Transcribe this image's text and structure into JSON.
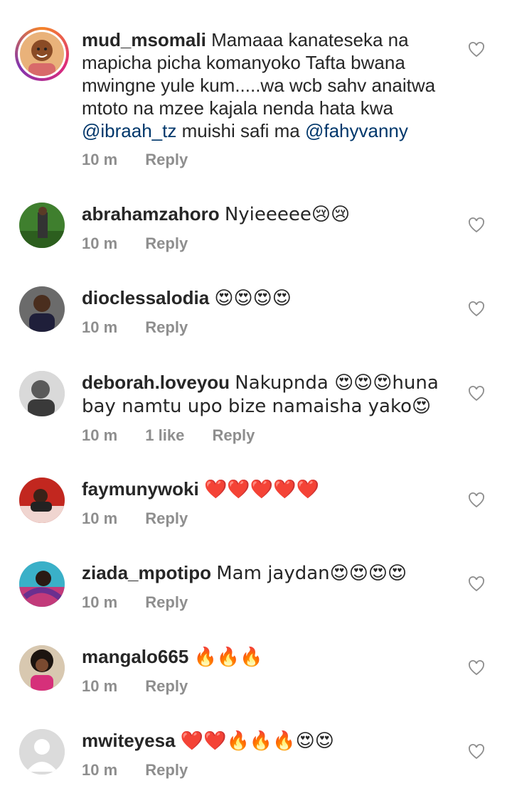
{
  "comments": [
    {
      "username": "mud_msomali",
      "text_parts": [
        "Mamaaa kanateseka na mapicha picha komanyoko Tafta bwana mwingne yule kum.....wa wcb sahv anaitwa mtoto na mzee kajala nenda hata kwa ",
        " muishi safi ma "
      ],
      "mentions": [
        "@ibraah_tz",
        "@fahyvanny"
      ],
      "time": "10 m",
      "reply": "Reply"
    },
    {
      "username": "abrahamzahoro",
      "text": "Nyieeeee😢😢",
      "time": "10 m",
      "reply": "Reply"
    },
    {
      "username": "dioclessalodia",
      "text": "😍😍😍😍",
      "time": "10 m",
      "reply": "Reply"
    },
    {
      "username": "deborah.loveyou",
      "text": "Nakupnda 😍😍😍huna bay namtu upo bize namaisha yako😍",
      "time": "10 m",
      "likes": "1 like",
      "reply": "Reply"
    },
    {
      "username": "faymunywoki",
      "text": "❤️❤️❤️❤️❤️",
      "time": "10 m",
      "reply": "Reply"
    },
    {
      "username": "ziada_mpotipo",
      "text": "Mam jaydan😍😍😍😍",
      "time": "10 m",
      "reply": "Reply"
    },
    {
      "username": "mangalo665",
      "text": "🔥🔥🔥",
      "time": "10 m",
      "reply": "Reply"
    },
    {
      "username": "mwiteyesa",
      "text": "❤️❤️🔥🔥🔥😍😍",
      "time": "10 m",
      "reply": "Reply"
    }
  ],
  "icons": {
    "like": "heart-outline-icon",
    "avatar": "user-avatar-icon"
  },
  "colors": {
    "text": "#262626",
    "meta": "#8e8e8e",
    "mention": "#00376b"
  }
}
